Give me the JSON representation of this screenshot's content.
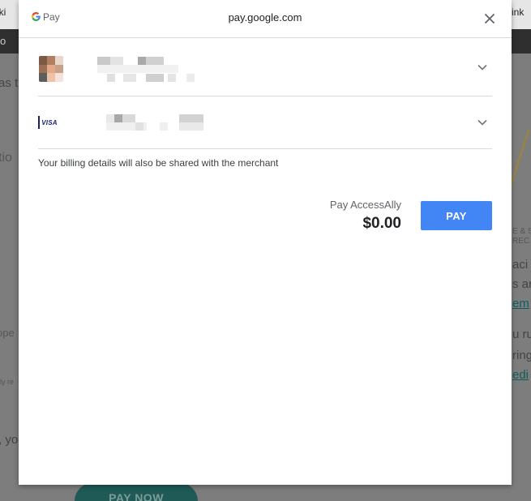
{
  "background": {
    "tab_left": "iki",
    "tab_right": "ink",
    "darkbar_left": "o",
    "fragments": [
      "as t",
      "tio",
      "ope",
      "lly re",
      ", yo",
      "aci",
      "s ar",
      "em",
      "u ru",
      "ring",
      "edi",
      "E & S",
      "REC"
    ],
    "pill_label": "PAY NOW"
  },
  "dialog": {
    "logo_text": "Pay",
    "title": "pay.google.com",
    "billing_note": "Your billing details will also be shared with the merchant",
    "merchant_label": "Pay AccessAlly",
    "total": "$0.00",
    "pay_label": "PAY",
    "card_brand": "VISA",
    "icons": {
      "close": "close-icon",
      "expand": "chevron-down-icon",
      "card": "visa-icon",
      "logo": "google-g-icon"
    }
  },
  "colors": {
    "accent": "#4285f4",
    "overlay": "#7d7d7d",
    "divider": "#dadada"
  }
}
